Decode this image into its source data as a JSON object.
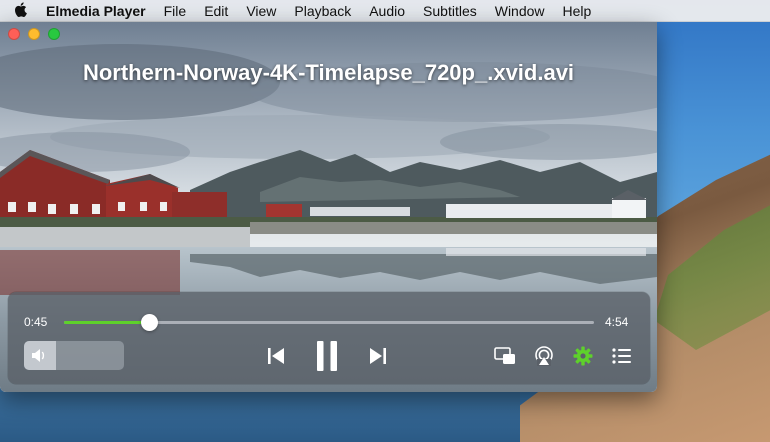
{
  "menubar": {
    "app_name": "Elmedia Player",
    "items": [
      "File",
      "Edit",
      "View",
      "Playback",
      "Audio",
      "Subtitles",
      "Window",
      "Help"
    ]
  },
  "window": {
    "title": "Northern-Norway-4K-Timelapse_720p_.xvid.avi"
  },
  "player": {
    "current_time": "0:45",
    "duration": "4:54",
    "progress_fraction": 0.161,
    "volume_fraction": 0.32,
    "state": "playing"
  },
  "icons": {
    "apple": "apple-logo-icon",
    "volume": "speaker-icon",
    "previous": "skip-previous-icon",
    "pause": "pause-icon",
    "next": "skip-next-icon",
    "pip": "picture-in-picture-icon",
    "airplay": "airplay-icon",
    "settings": "gear-icon",
    "playlist": "playlist-icon"
  },
  "colors": {
    "progress_accent": "#5ed12b",
    "settings_accent": "#5ed12b"
  }
}
